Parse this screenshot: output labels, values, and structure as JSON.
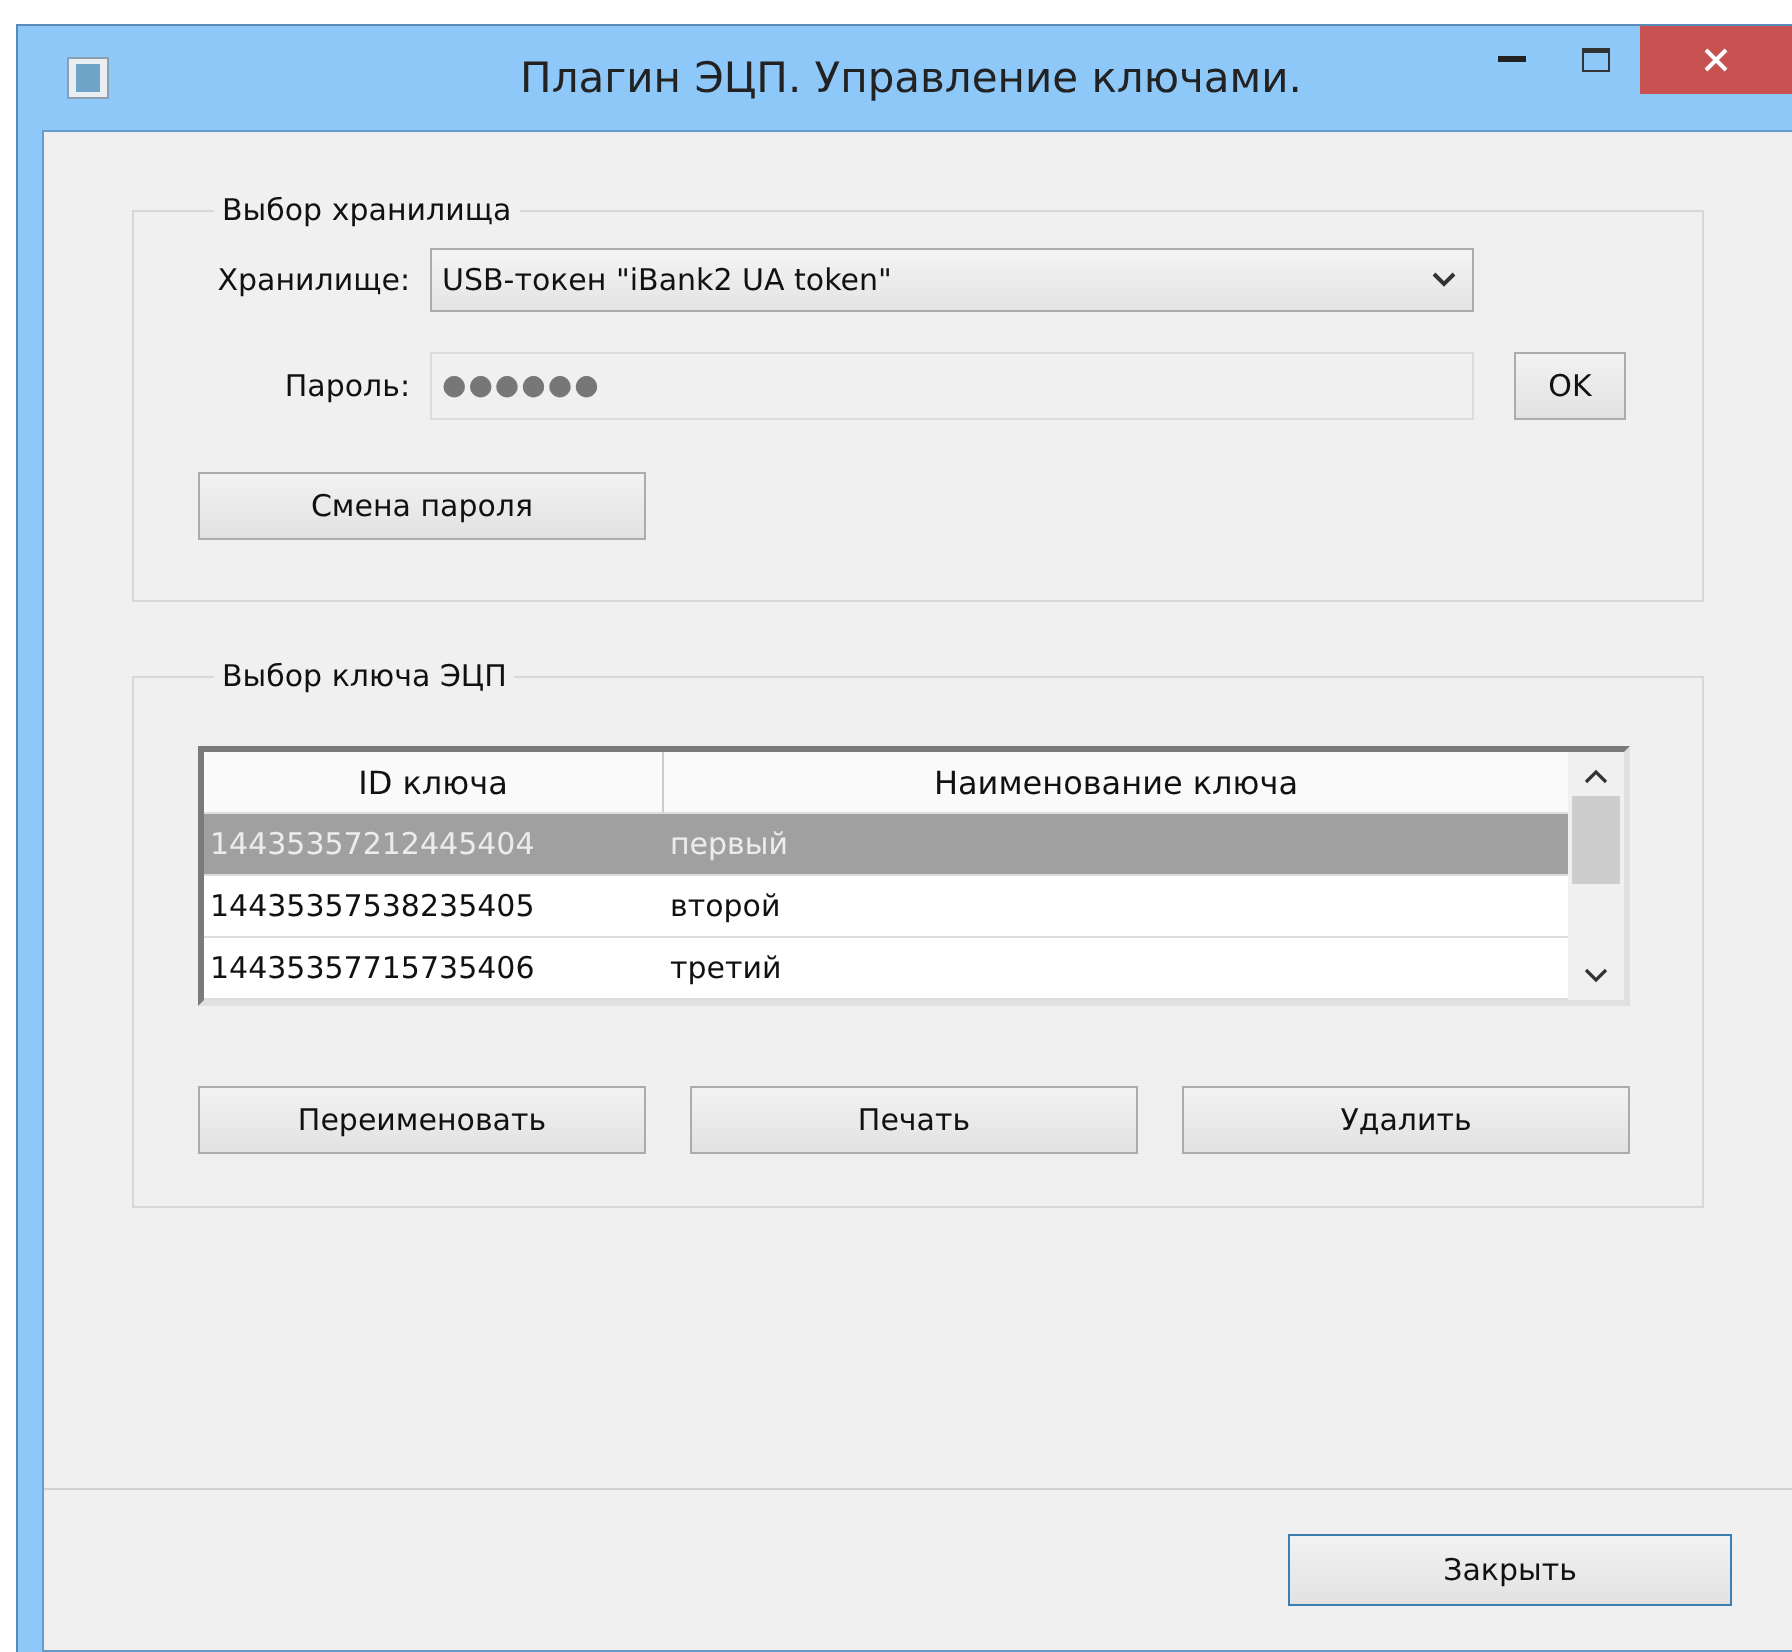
{
  "window": {
    "title": "Плагин ЭЦП. Управление ключами."
  },
  "storage_group": {
    "legend": "Выбор хранилища",
    "storage_label": "Хранилище:",
    "storage_value": "USB-токен \"iBank2 UA token\"",
    "password_label": "Пароль:",
    "password_value": "●●●●●●",
    "ok_button": "OK",
    "change_password_button": "Смена пароля"
  },
  "key_group": {
    "legend": "Выбор ключа ЭЦП",
    "table": {
      "columns": [
        "ID ключа",
        "Наименование ключа"
      ],
      "rows": [
        {
          "id": "14435357212445404",
          "name": "первый",
          "selected": true
        },
        {
          "id": "14435357538235405",
          "name": "второй",
          "selected": false
        },
        {
          "id": "14435357715735406",
          "name": "третий",
          "selected": false
        }
      ]
    },
    "buttons": [
      "Переименовать",
      "Печать",
      "Удалить"
    ]
  },
  "footer": {
    "close_button": "Закрыть"
  }
}
